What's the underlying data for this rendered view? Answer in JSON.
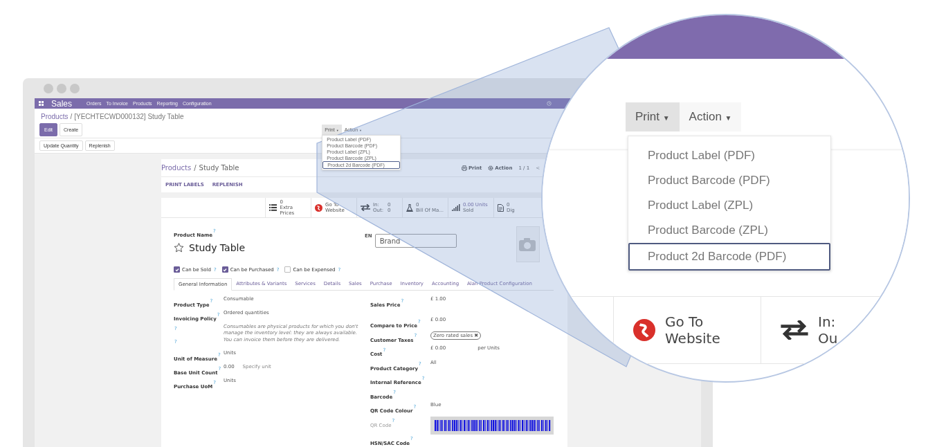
{
  "navbar": {
    "app": "Sales",
    "menu": [
      "Orders",
      "To Invoice",
      "Products",
      "Reporting",
      "Configuration"
    ]
  },
  "breadcrumb": {
    "parent": "Products",
    "separator": "/",
    "current": "[YECHTECWD000132] Study Table"
  },
  "buttons": [
    {
      "label": "Edit",
      "kind": "primary"
    },
    {
      "label": "Create",
      "kind": "secondary"
    }
  ],
  "dropdowns": [
    {
      "label": "Print",
      "caret": "▼",
      "open": true
    },
    {
      "label": "Action",
      "caret": "▼",
      "open": false
    }
  ],
  "print_menu": [
    {
      "label": "Product Label (PDF)",
      "selected": false
    },
    {
      "label": "Product Barcode (PDF)",
      "selected": false
    },
    {
      "label": "Product Label (ZPL)",
      "selected": false
    },
    {
      "label": "Product Barcode (ZPL)",
      "selected": false
    },
    {
      "label": "Product 2d Barcode (PDF)",
      "selected": true
    }
  ],
  "extra_buttons": [
    "Update Quantity",
    "Replenish"
  ],
  "form": {
    "breadcrumb": {
      "parent": "Products",
      "separator": "/",
      "current": "Study Table"
    },
    "actions": [
      {
        "label": "Print",
        "kind": "print"
      },
      {
        "label": "Action",
        "kind": "gear"
      }
    ],
    "pager": "1 / 1",
    "pager_prev": "<",
    "header_buttons": [
      "PRINT LABELS",
      "REPLENISH"
    ],
    "stats": [
      {
        "kind": "count",
        "value": "0",
        "label": "Extra Prices"
      },
      {
        "kind": "link",
        "value": "Go To",
        "label": "Website"
      },
      {
        "kind": "inout",
        "in_label": "In:",
        "in_value": "0",
        "out_label": "Out:",
        "out_value": "0"
      },
      {
        "kind": "bom",
        "value": "0",
        "label": "Bill Of Ma..."
      },
      {
        "kind": "sold",
        "value": "0.00 Units",
        "label": "Sold"
      },
      {
        "kind": "doc",
        "value": "0",
        "label": "Dig"
      }
    ],
    "name_label": "Product Name",
    "name_help": "?",
    "name": "Study Table",
    "starred": false,
    "lang": "EN",
    "brand_placeholder": "Brand",
    "options": [
      {
        "label": "Can be Sold",
        "help": "?",
        "checked": true
      },
      {
        "label": "Can be Purchased",
        "help": "?",
        "checked": true
      },
      {
        "label": "Can be Expensed",
        "help": "?",
        "checked": false
      }
    ],
    "tabs": [
      {
        "label": "General Information",
        "selected": true
      },
      {
        "label": "Attributes & Variants",
        "selected": false
      },
      {
        "label": "Services",
        "selected": false
      },
      {
        "label": "Details",
        "selected": false
      },
      {
        "label": "Sales",
        "selected": false
      },
      {
        "label": "Purchase",
        "selected": false
      },
      {
        "label": "Inventory",
        "selected": false
      },
      {
        "label": "Accounting",
        "selected": false
      },
      {
        "label": "Alan Product Configuration",
        "selected": false
      }
    ],
    "left_fields": [
      {
        "kind": "field",
        "label": "Product Type",
        "help": "?",
        "value": "Consumable"
      },
      {
        "kind": "field",
        "label": "Invoicing Policy",
        "help": "?",
        "value": "Ordered quantities"
      },
      {
        "kind": "note",
        "help": "?",
        "value": "Consumables are physical products for which you don't manage the inventory level: they are always available."
      },
      {
        "kind": "note",
        "help": "?",
        "value": "You can invoice them before they are delivered."
      },
      {
        "kind": "field",
        "label": "Unit of Measure",
        "help": "?",
        "value": "Units"
      },
      {
        "kind": "field",
        "label": "Base Unit Count",
        "help": "?",
        "value": "0.00",
        "extra": "Specify unit"
      },
      {
        "kind": "field",
        "label": "Purchase UoM",
        "help": "?",
        "value": "Units"
      }
    ],
    "right_fields": [
      {
        "kind": "field",
        "label": "Sales Price",
        "help": "?",
        "value": "£ 1.00"
      },
      {
        "kind": "field",
        "label": "Compare to Price",
        "help": "?",
        "value": "£ 0.00"
      },
      {
        "kind": "tag",
        "label": "Customer Taxes",
        "help": "?",
        "value": "Zero rated sales",
        "remove": "✖"
      },
      {
        "kind": "field",
        "label": "Cost",
        "help": "?",
        "value": "£ 0.00",
        "extra": "per Units"
      },
      {
        "kind": "field",
        "label": "Product Category",
        "help": "?",
        "value": "All"
      },
      {
        "kind": "field",
        "label": "Internal Reference",
        "help": "?"
      },
      {
        "kind": "field",
        "label": "Barcode",
        "help": "?"
      },
      {
        "kind": "field",
        "label": "QR Code Colour",
        "help": "?",
        "value": "Blue"
      },
      {
        "kind": "image",
        "label": "QR Code",
        "help": "?"
      },
      {
        "kind": "field",
        "label": "HSN/SAC Code",
        "help": "?"
      }
    ]
  },
  "magnifier": {
    "buttons": [
      {
        "label": "Print",
        "caret": "▼",
        "open": true
      },
      {
        "label": "Action",
        "caret": "▼",
        "open": false
      }
    ],
    "menu": [
      {
        "label": "Product Label (PDF)",
        "selected": false
      },
      {
        "label": "Product Barcode (PDF)",
        "selected": false
      },
      {
        "label": "Product Label (ZPL)",
        "selected": false
      },
      {
        "label": "Product Barcode (ZPL)",
        "selected": false
      },
      {
        "label": "Product 2d Barcode (PDF)",
        "selected": true
      }
    ],
    "stats": [
      {
        "kind": "link",
        "value": "Go To",
        "label": "Website"
      },
      {
        "kind": "inout",
        "value": "In:",
        "label": "Ou"
      }
    ]
  }
}
